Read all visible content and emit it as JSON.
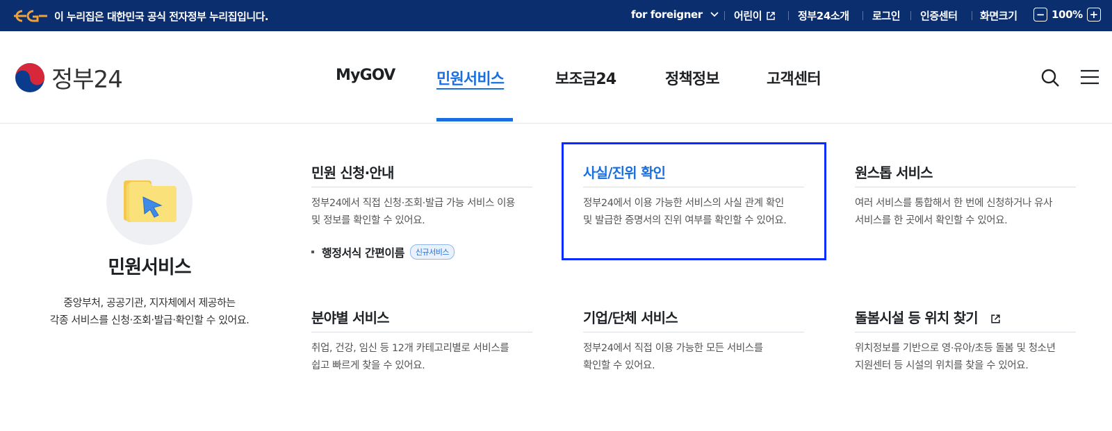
{
  "gov_banner": {
    "text": "이 누리집은 대한민국 공식 전자정부 누리집입니다.",
    "links": [
      {
        "label": "for foreigner",
        "icon": "chevron-down-icon"
      },
      {
        "label": "어린이",
        "icon": "external-link-icon"
      },
      {
        "label": "정부24소개"
      },
      {
        "label": "로그인"
      },
      {
        "label": "인증센터"
      },
      {
        "label": "화면크기"
      }
    ],
    "zoom_decrease": "−",
    "zoom_level": "100%",
    "zoom_increase": "+"
  },
  "header": {
    "logo_text": "정부24",
    "nav": [
      {
        "label": "MyGOV"
      },
      {
        "label": "민원서비스",
        "active": true
      },
      {
        "label": "보조금24"
      },
      {
        "label": "정책정보"
      },
      {
        "label": "고객센터"
      }
    ]
  },
  "panel": {
    "title": "민원서비스",
    "desc_line1": "중앙부처, 공공기관, 지자체에서 제공하는",
    "desc_line2": "각종 서비스를 신청·조회·발급·확인할 수 있어요."
  },
  "cards": [
    {
      "title": "민원 신청·안내",
      "desc_line1": "정부24에서 직접 신청·조회·발급 가능 서비스 이용",
      "desc_line2": "및 정보를 확인할 수 있어요.",
      "sub_link": "행정서식 간편이름",
      "badge": "신규서비스"
    },
    {
      "title": "사실/진위 확인",
      "desc_line1": "정부24에서 이용 가능한 서비스의 사실 관계 확인",
      "desc_line2": "및 발급한 증명서의 진위 여부를 확인할 수 있어요."
    },
    {
      "title": "원스톱 서비스",
      "desc_line1": "여러 서비스를 통합해서 한 번에 신청하거나 유사",
      "desc_line2": "서비스를 한 곳에서 확인할 수 있어요."
    },
    {
      "title": "분야별 서비스",
      "desc_line1": "취업, 건강, 임신 등 12개 카테고리별로 서비스를",
      "desc_line2": "쉽고 빠르게 찾을 수 있어요."
    },
    {
      "title": "기업/단체 서비스",
      "desc_line1": "정부24에서 직접 이용 가능한 모든 서비스를",
      "desc_line2": "확인할 수 있어요."
    },
    {
      "title": "돌봄시설 등 위치 찾기",
      "desc_line1": "위치정보를 기반으로 영·유아/초등 돌봄 및 청소년",
      "desc_line2": "지원센터 등 시설의 위치를 찾을 수 있어요."
    }
  ],
  "colors": {
    "gov_bar": "#0b2e6e",
    "accent": "#1a6fe0",
    "highlight": "#0a2bff"
  }
}
